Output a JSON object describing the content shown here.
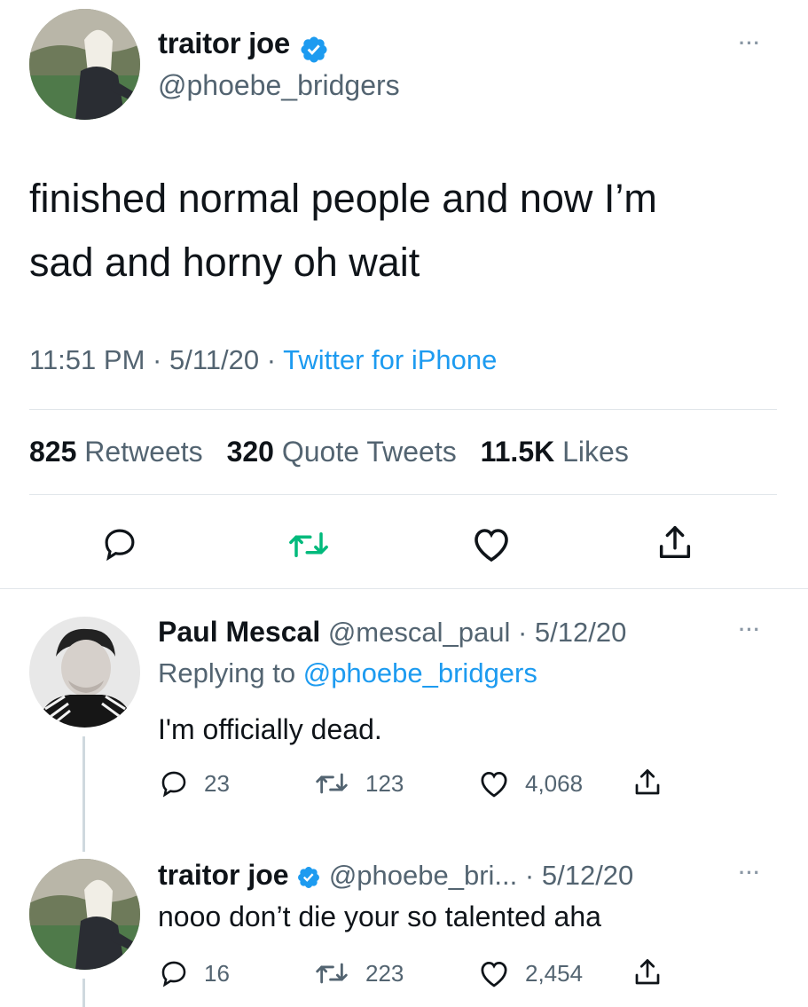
{
  "main_tweet": {
    "display_name": "traitor joe",
    "handle": "@phoebe_bridgers",
    "text_line1": "finished normal people and now I’m",
    "text_line2": "sad and horny oh wait",
    "time": "11:51 PM",
    "date": "5/11/20",
    "source": "Twitter for iPhone",
    "sep": "·",
    "retweets_count": "825",
    "retweets_label": "Retweets",
    "quotes_count": "320",
    "quotes_label": "Quote Tweets",
    "likes_count": "11.5K",
    "likes_label": "Likes",
    "more": "···"
  },
  "reply1": {
    "display_name": "Paul Mescal",
    "handle": "@mescal_paul",
    "date": "5/12/20",
    "replying_prefix": "Replying to",
    "replying_to": "@phoebe_bridgers",
    "text": "I'm officially dead.",
    "replies": "23",
    "retweets": "123",
    "likes": "4,068",
    "more": "···"
  },
  "reply2": {
    "display_name": "traitor joe",
    "handle": "@phoebe_bri...",
    "date": "5/12/20",
    "text": "nooo don’t die your so talented aha",
    "replies": "16",
    "retweets": "223",
    "likes": "2,454",
    "more": "···"
  },
  "colors": {
    "accent": "#1d9bf0",
    "retweet_active": "#00ba7c",
    "secondary_text": "#536471"
  },
  "icons": [
    "verified-badge-icon",
    "reply-icon",
    "retweet-icon",
    "like-icon",
    "share-icon",
    "more-icon"
  ]
}
